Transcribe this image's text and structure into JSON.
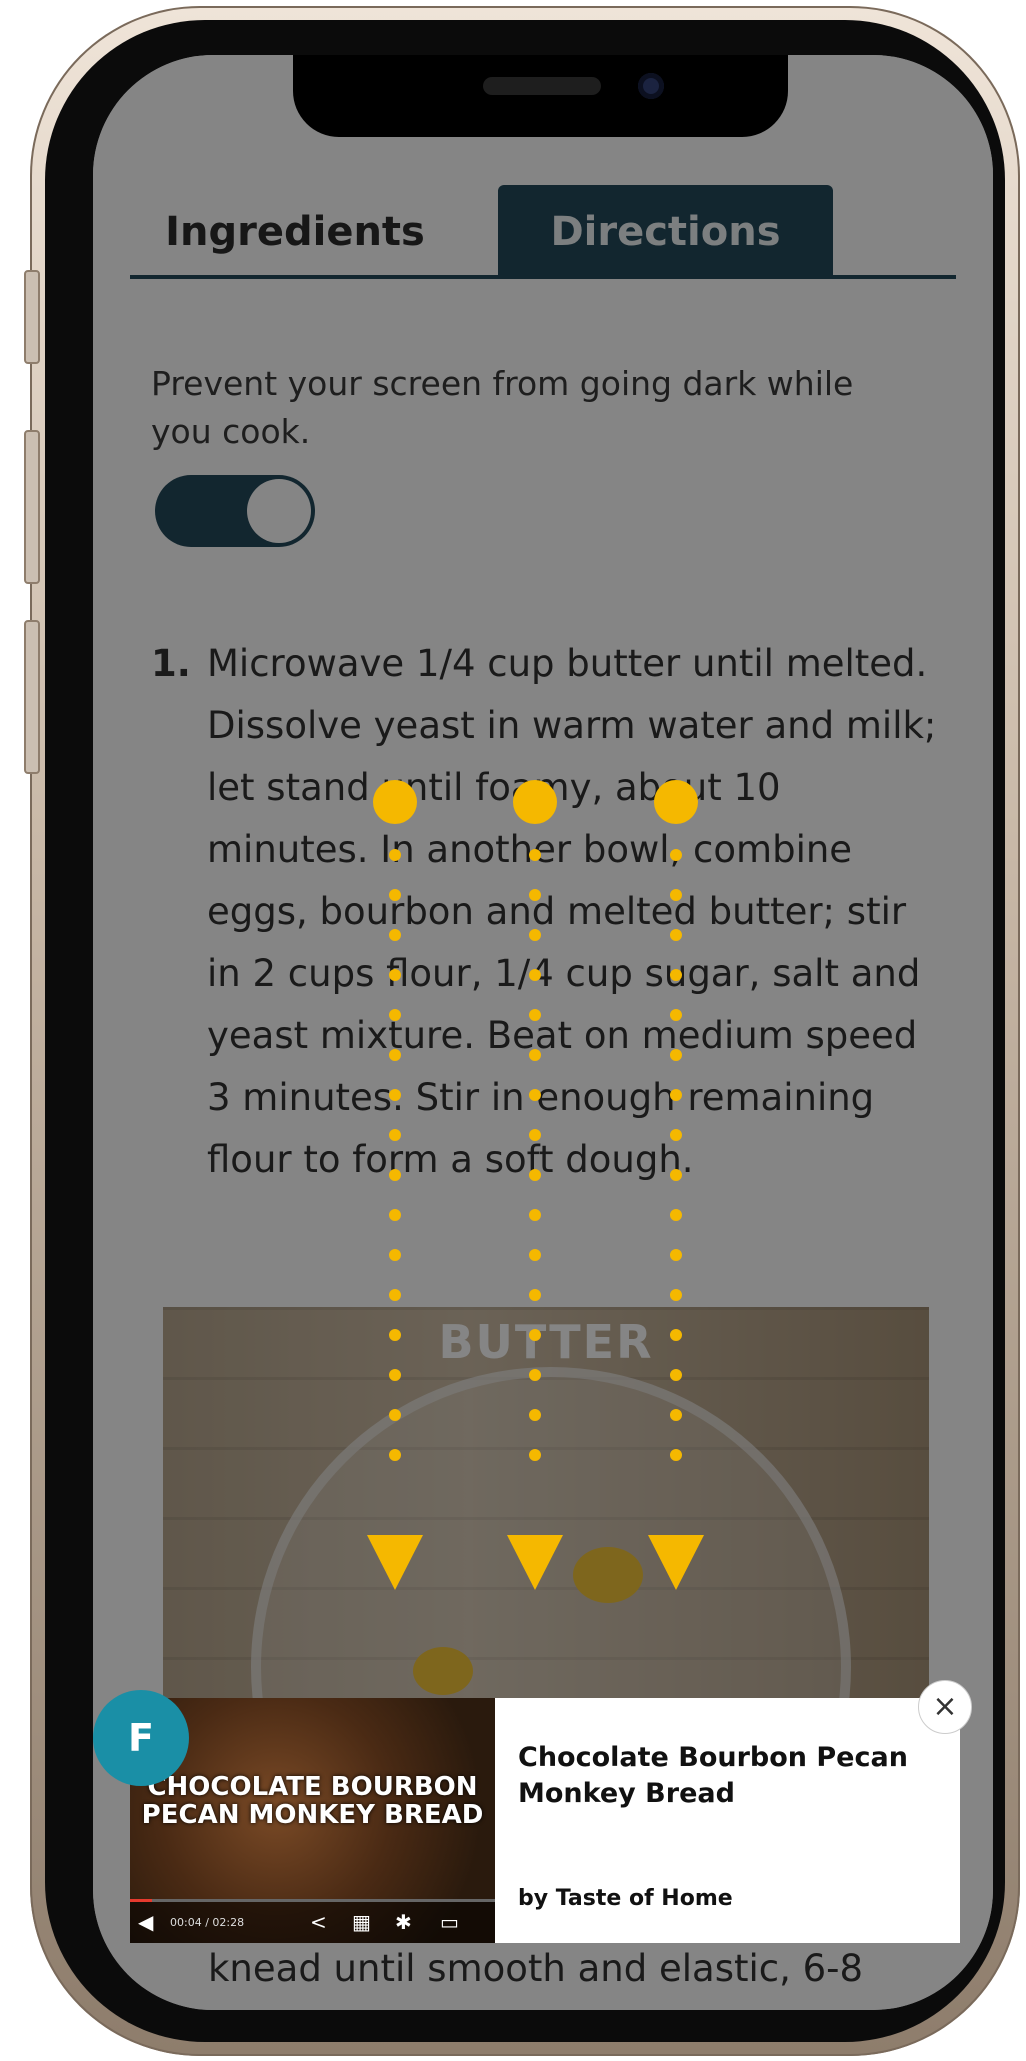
{
  "tabs": {
    "ingredients": "Ingredients",
    "directions": "Directions",
    "active": "Directions"
  },
  "screen_on": {
    "description": "Prevent your screen from going dark while you cook.",
    "toggle_on": true
  },
  "steps": [
    {
      "number": "1.",
      "text": "Microwave 1/4 cup butter until melted. Dissolve yeast in warm water and milk; let stand until foamy, about 10 minutes. In another bowl, combine eggs, bourbon and melted butter; stir in 2 cups flour, 1/4 cup sugar, salt and yeast mixture. Beat on medium speed 3 minutes. Stir in enough remaining flour to form a soft dough."
    }
  ],
  "step_image_label": "BUTTER",
  "next_step_partial": "knead until smooth and elastic, 6-8",
  "ad": {
    "badge": "F",
    "thumb_title": "CHOCOLATE BOURBON PECAN MONKEY BREAD",
    "time": "00:04 / 02:28",
    "progress": 0.06,
    "title": "Chocolate Bourbon Pecan Monkey Bread",
    "by": "by Taste of Home",
    "close_icon": "×"
  },
  "gesture_hint": {
    "type": "three-finger-swipe-down",
    "color": "#f5b800"
  }
}
